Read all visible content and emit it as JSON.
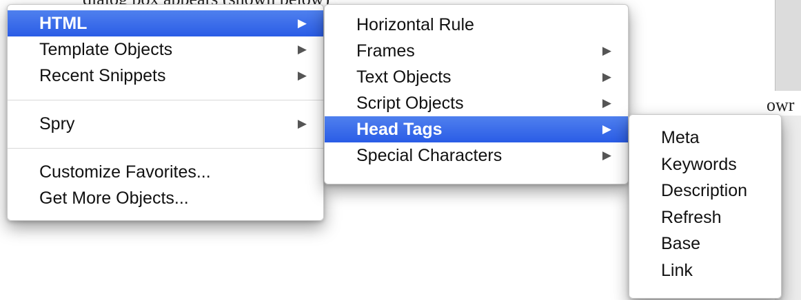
{
  "background": {
    "top_text": "dialog box appears (shown below)",
    "right_text": "owr"
  },
  "main_menu": {
    "items": [
      {
        "label": "HTML",
        "submenu": true,
        "active": true
      },
      {
        "label": "Template Objects",
        "submenu": true
      },
      {
        "label": "Recent Snippets",
        "submenu": true
      },
      {
        "label": "Spry",
        "submenu": true
      },
      {
        "label": "Customize Favorites...",
        "submenu": false
      },
      {
        "label": "Get More Objects...",
        "submenu": false
      }
    ]
  },
  "html_submenu": {
    "items": [
      {
        "label": "Horizontal Rule",
        "submenu": false
      },
      {
        "label": "Frames",
        "submenu": true
      },
      {
        "label": "Text Objects",
        "submenu": true
      },
      {
        "label": "Script Objects",
        "submenu": true
      },
      {
        "label": "Head Tags",
        "submenu": true,
        "active": true
      },
      {
        "label": "Special Characters",
        "submenu": true
      }
    ]
  },
  "head_tags_submenu": {
    "items": [
      {
        "label": "Meta"
      },
      {
        "label": "Keywords"
      },
      {
        "label": "Description"
      },
      {
        "label": "Refresh"
      },
      {
        "label": "Base"
      },
      {
        "label": "Link"
      }
    ]
  },
  "icons": {
    "submenu_arrow": "▶"
  },
  "colors": {
    "highlight": "#2a5ce6"
  }
}
